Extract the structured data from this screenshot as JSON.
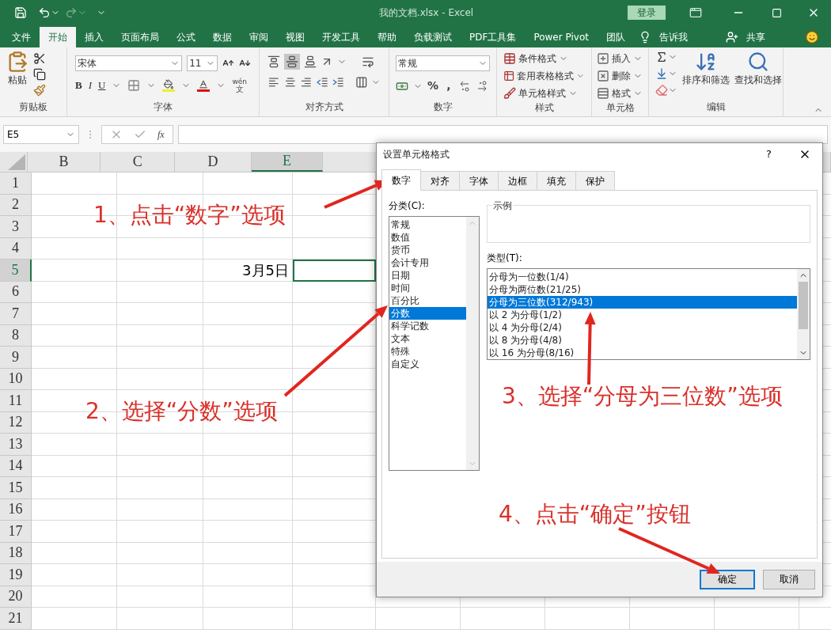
{
  "title_bar": {
    "title": "我的文档.xlsx  -  Excel",
    "sign_in": "登录"
  },
  "menu_tabs": [
    {
      "label": "文件",
      "selected": false
    },
    {
      "label": "开始",
      "selected": true
    },
    {
      "label": "插入",
      "selected": false
    },
    {
      "label": "页面布局",
      "selected": false
    },
    {
      "label": "公式",
      "selected": false
    },
    {
      "label": "数据",
      "selected": false
    },
    {
      "label": "审阅",
      "selected": false
    },
    {
      "label": "视图",
      "selected": false
    },
    {
      "label": "开发工具",
      "selected": false
    },
    {
      "label": "帮助",
      "selected": false
    },
    {
      "label": "负载测试",
      "selected": false
    },
    {
      "label": "PDF工具集",
      "selected": false
    },
    {
      "label": "Power Pivot",
      "selected": false
    },
    {
      "label": "团队",
      "selected": false
    }
  ],
  "tell_me": "告诉我",
  "share": "共享",
  "ribbon": {
    "clipboard": {
      "paste": "粘贴",
      "label": "剪贴板"
    },
    "font": {
      "font_name": "宋体",
      "font_size": "11",
      "styles": [
        "B",
        "I",
        "U"
      ],
      "phonetic": [
        "wén",
        "文"
      ],
      "label": "字体"
    },
    "alignment": {
      "label": "对齐方式"
    },
    "number": {
      "format": "常规",
      "symbols": [
        "%",
        ","
      ],
      "label": "数字"
    },
    "styles": {
      "items": [
        "条件格式",
        "套用表格格式",
        "单元格样式"
      ],
      "label": "样式"
    },
    "cells": {
      "items": [
        "插入",
        "删除",
        "格式"
      ],
      "label": "单元格"
    },
    "editing": {
      "sort": "排序和筛选",
      "find": "查找和选择",
      "label": "编辑"
    }
  },
  "formula_bar": {
    "name_box": "E5",
    "function_label": "fx"
  },
  "sheet": {
    "columns": [
      {
        "label": "B",
        "selected": false
      },
      {
        "label": "C",
        "selected": false
      },
      {
        "label": "D",
        "selected": false
      },
      {
        "label": "E",
        "selected": true
      }
    ],
    "rows": [
      {
        "label": "1",
        "selected": false
      },
      {
        "label": "2",
        "selected": false
      },
      {
        "label": "3",
        "selected": false
      },
      {
        "label": "4",
        "selected": false
      },
      {
        "label": "5",
        "selected": true,
        "value": "3月5日"
      },
      {
        "label": "6",
        "selected": false
      },
      {
        "label": "7",
        "selected": false
      },
      {
        "label": "8",
        "selected": false
      },
      {
        "label": "9",
        "selected": false
      },
      {
        "label": "10",
        "selected": false
      },
      {
        "label": "11",
        "selected": false
      },
      {
        "label": "12",
        "selected": false
      },
      {
        "label": "13",
        "selected": false
      },
      {
        "label": "14",
        "selected": false
      },
      {
        "label": "15",
        "selected": false
      },
      {
        "label": "16",
        "selected": false
      },
      {
        "label": "17",
        "selected": false
      },
      {
        "label": "18",
        "selected": false
      },
      {
        "label": "19",
        "selected": false
      },
      {
        "label": "20",
        "selected": false
      },
      {
        "label": "21",
        "selected": false
      }
    ]
  },
  "dialog": {
    "title": "设置单元格格式",
    "help": "?",
    "tabs": [
      {
        "label": "数字",
        "selected": true
      },
      {
        "label": "对齐",
        "selected": false
      },
      {
        "label": "字体",
        "selected": false
      },
      {
        "label": "边框",
        "selected": false
      },
      {
        "label": "填充",
        "selected": false
      },
      {
        "label": "保护",
        "selected": false
      }
    ],
    "category_label": "分类(C):",
    "categories": [
      {
        "label": "常规",
        "selected": false
      },
      {
        "label": "数值",
        "selected": false
      },
      {
        "label": "货币",
        "selected": false
      },
      {
        "label": "会计专用",
        "selected": false
      },
      {
        "label": "日期",
        "selected": false
      },
      {
        "label": "时间",
        "selected": false
      },
      {
        "label": "百分比",
        "selected": false
      },
      {
        "label": "分数",
        "selected": true
      },
      {
        "label": "科学记数",
        "selected": false
      },
      {
        "label": "文本",
        "selected": false
      },
      {
        "label": "特殊",
        "selected": false
      },
      {
        "label": "自定义",
        "selected": false
      }
    ],
    "sample_label": "示例",
    "type_label": "类型(T):",
    "types": [
      {
        "label": "分母为一位数(1/4)",
        "selected": false
      },
      {
        "label": "分母为两位数(21/25)",
        "selected": false
      },
      {
        "label": "分母为三位数(312/943)",
        "selected": true
      },
      {
        "label": "以 2 为分母(1/2)",
        "selected": false
      },
      {
        "label": "以 4 为分母(2/4)",
        "selected": false
      },
      {
        "label": "以 8 为分母(4/8)",
        "selected": false
      },
      {
        "label": "以 16 为分母(8/16)",
        "selected": false
      }
    ],
    "ok": "确定",
    "cancel": "取消"
  },
  "annotations": [
    "1、点击“数字”选项",
    "2、选择“分数”选项",
    "3、选择“分母为三位数”选项",
    "4、点击“确定”按钮"
  ]
}
